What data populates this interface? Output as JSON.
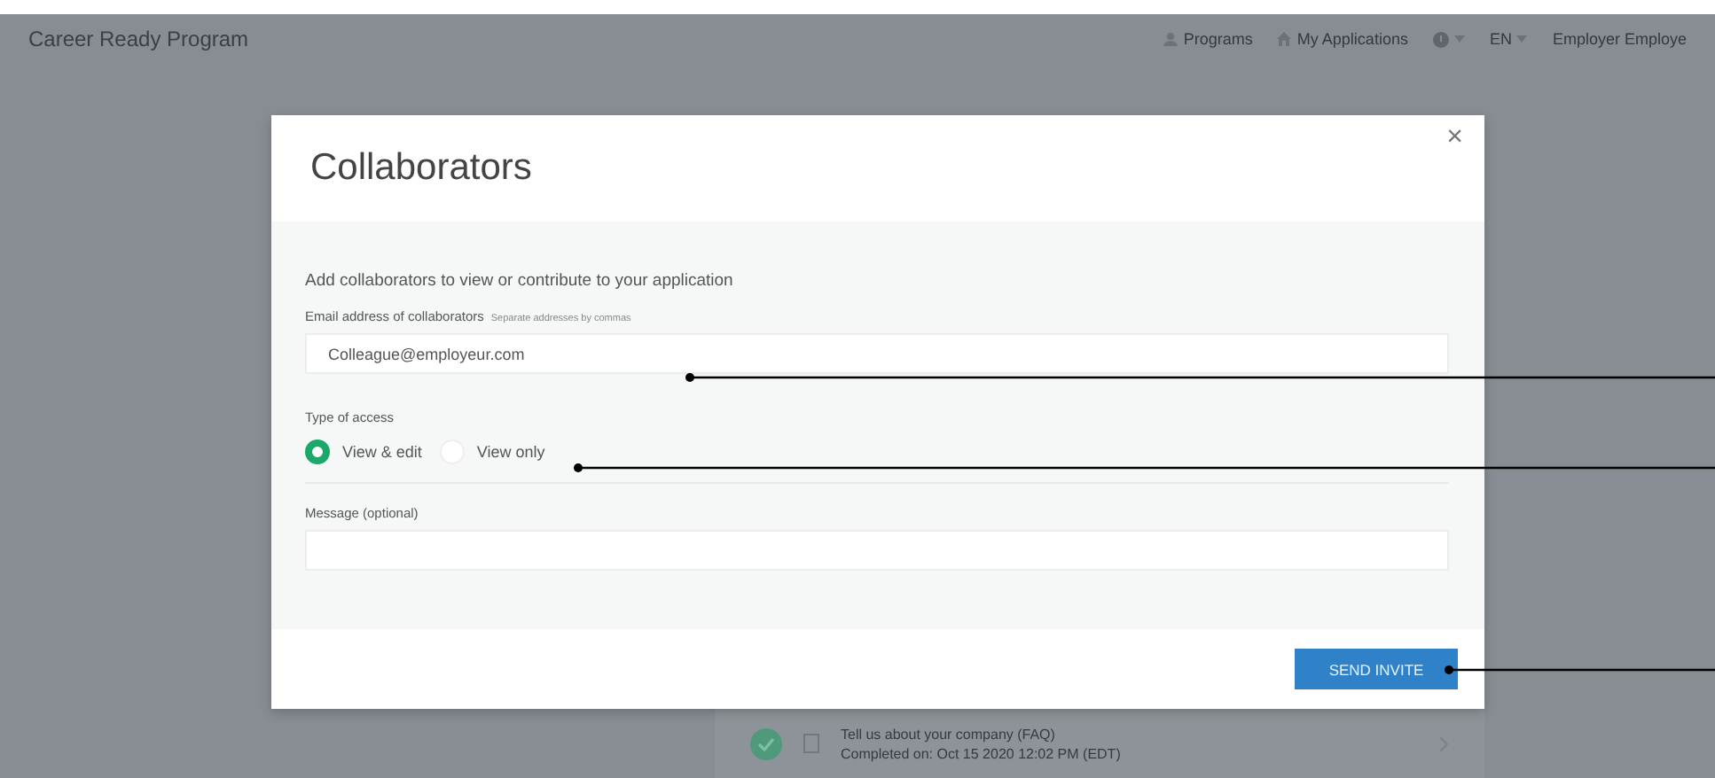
{
  "navbar": {
    "brand": "Career Ready Program",
    "links": [
      {
        "kind": "person",
        "label": "Programs"
      },
      {
        "kind": "home",
        "label": "My Applications"
      },
      {
        "kind": "help"
      },
      {
        "kind": "text",
        "label": "EN"
      },
      {
        "kind": "plain",
        "label": "Employer Employe"
      }
    ]
  },
  "background_task": {
    "title": "Tell us about your company (FAQ)",
    "subtitle": "Completed on: Oct 15 2020 12:02 PM (EDT)",
    "completed": true
  },
  "modal": {
    "title": "Collaborators",
    "close": "×",
    "intro": "Add collaborators to view or contribute to your application",
    "email": {
      "label": "Email address of collaborators",
      "hint": "Separate addresses by commas",
      "value": "Colleague@employeur.com"
    },
    "access": {
      "label": "Type of access",
      "options": [
        {
          "label": "View & edit",
          "selected": true
        },
        {
          "label": "View only",
          "selected": false
        }
      ]
    },
    "message": {
      "label": "Message (optional)"
    },
    "button": "SEND INVITE"
  }
}
